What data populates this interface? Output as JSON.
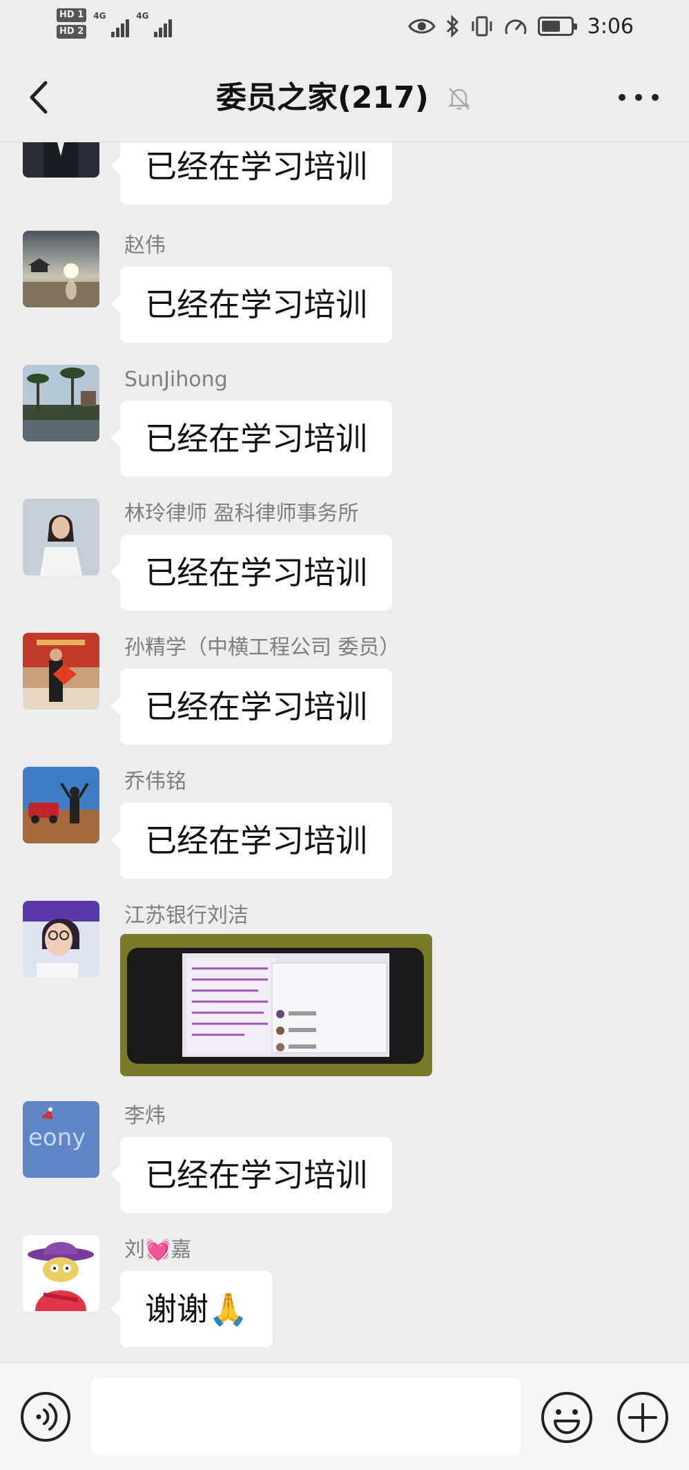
{
  "status_bar": {
    "sim1_tag": "HD 1",
    "sim2_tag": "HD 2",
    "network1": "4G",
    "network2": "4G",
    "time": "3:06",
    "battery_level": 0.65,
    "icons": [
      "eye-icon",
      "bluetooth-icon",
      "vibrate-icon",
      "speed-icon",
      "battery-icon"
    ]
  },
  "nav": {
    "title": "委员之家(217)",
    "back_icon": "chevron-left-icon",
    "muted_icon": "bell-muted-icon",
    "more_icon": "more-dots-icon"
  },
  "messages": [
    {
      "sender": "",
      "type": "text",
      "text": "已经在学习培训",
      "avatar": "avatar-suit"
    },
    {
      "sender": "赵伟",
      "type": "text",
      "text": "已经在学习培训",
      "avatar": "avatar-sunset-lake"
    },
    {
      "sender": "SunJihong",
      "type": "text",
      "text": "已经在学习培训",
      "avatar": "avatar-palm-trees"
    },
    {
      "sender": "林玲律师 盈科律师事务所",
      "type": "text",
      "text": "已经在学习培训",
      "avatar": "avatar-lawyer-woman"
    },
    {
      "sender": "孙精学（中横工程公司  委员）",
      "type": "text",
      "text": "已经在学习培训",
      "avatar": "avatar-red-banner"
    },
    {
      "sender": "乔伟铭",
      "type": "text",
      "text": "已经在学习培训",
      "avatar": "avatar-truck-desert"
    },
    {
      "sender": "江苏银行刘洁",
      "type": "image",
      "text": "",
      "avatar": "avatar-woman-glasses"
    },
    {
      "sender": "李炜",
      "type": "text",
      "text": "已经在学习培训",
      "avatar": "avatar-snow-writing"
    },
    {
      "sender": "刘💓嘉",
      "type": "text",
      "text": "谢谢🙏",
      "avatar": "avatar-cartoon-hat"
    }
  ],
  "input_bar": {
    "placeholder": "",
    "voice_icon": "voice-icon",
    "emoji_icon": "emoji-icon",
    "plus_icon": "plus-icon"
  }
}
